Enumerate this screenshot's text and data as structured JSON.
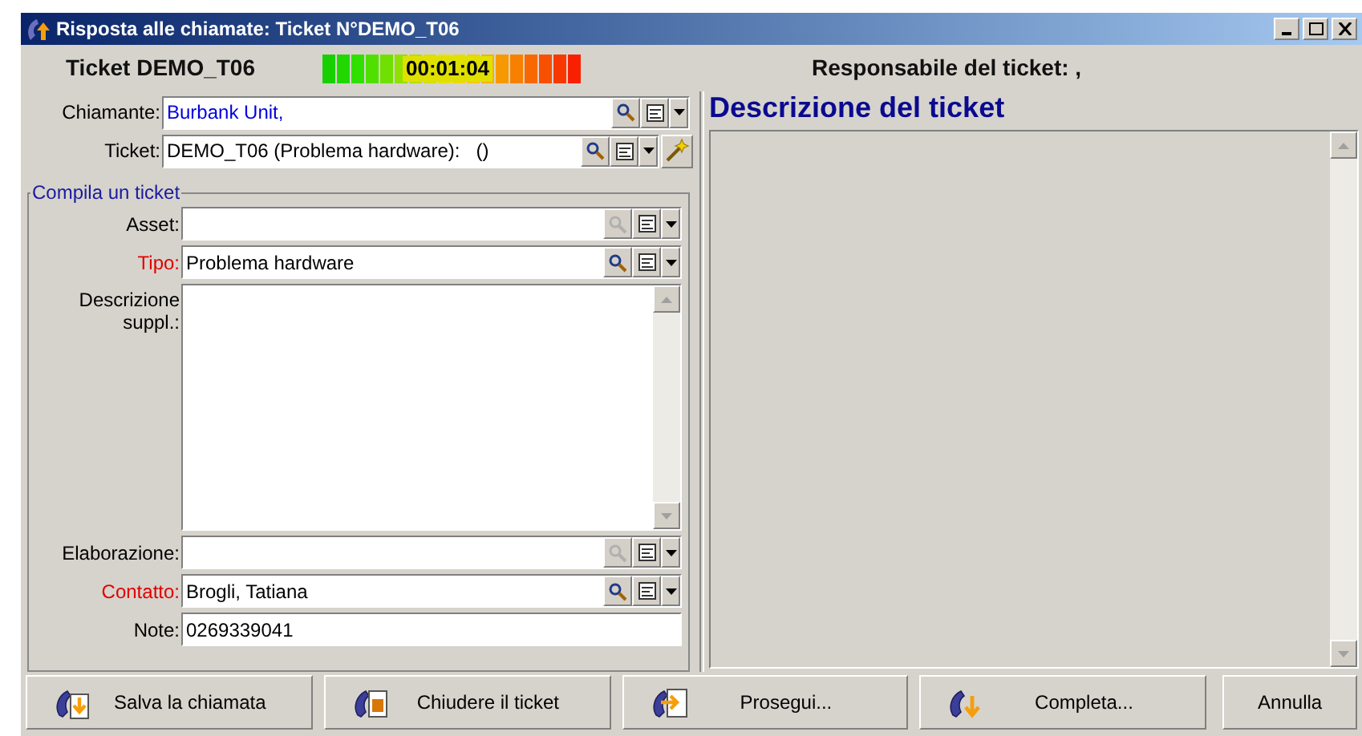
{
  "window": {
    "title": "Risposta alle chiamate: Ticket N°DEMO_T06"
  },
  "header": {
    "ticket": "Ticket DEMO_T06",
    "timer": "00:01:04",
    "owner": "Responsabile del ticket: ,"
  },
  "top_fields": [
    {
      "label": "Chiamante:",
      "value": "Burbank Unit,",
      "linked": true,
      "required": false,
      "search_enabled": true,
      "wizard": false
    },
    {
      "label": "Ticket:",
      "value": "DEMO_T06 (Problema hardware):   ()",
      "linked": false,
      "required": false,
      "search_enabled": true,
      "wizard": true
    }
  ],
  "group": {
    "title": "Compila un ticket",
    "fields": [
      {
        "kind": "lookup",
        "label": "Asset:",
        "required": false,
        "search_enabled": false
      },
      {
        "kind": "lookup",
        "label": "Tipo:",
        "value": "Problema hardware",
        "required": true,
        "search_enabled": true
      },
      {
        "kind": "memo",
        "label": "Descrizione suppl.:",
        "required": false
      },
      {
        "kind": "lookup",
        "label": "Elaborazione:",
        "required": false,
        "search_enabled": false
      },
      {
        "kind": "lookup",
        "label": "Contatto:",
        "value": "Brogli, Tatiana",
        "required": true,
        "search_enabled": true
      },
      {
        "kind": "text",
        "label": "Note:",
        "value": "0269339041",
        "required": false
      }
    ]
  },
  "description_panel": {
    "title": "Descrizione del ticket"
  },
  "buttons": [
    {
      "label": "Salva la chiamata",
      "kind": "save"
    },
    {
      "label": "Chiudere il ticket",
      "kind": "close"
    },
    {
      "label": "Prosegui...",
      "kind": "forward"
    },
    {
      "label": "Completa...",
      "kind": "complete"
    },
    {
      "label": "Annulla",
      "kind": "plain"
    }
  ]
}
